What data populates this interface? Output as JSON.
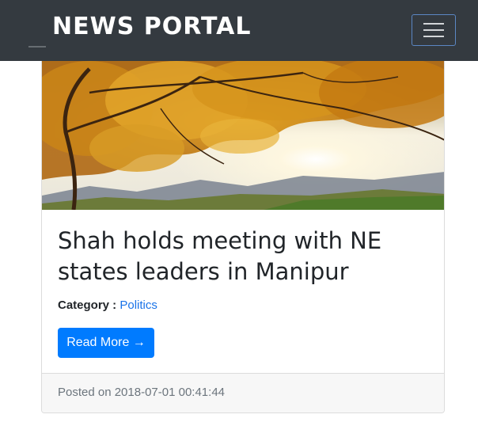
{
  "navbar": {
    "brand": "NEWS PORTAL",
    "menu_icon": "hamburger-menu-icon"
  },
  "post": {
    "image_icon": "autumn-tree-sunset-image",
    "title": "Shah holds meeting with NE states leaders in Manipur",
    "category_label": "Category :",
    "category_value": "Politics",
    "read_more_label": "Read More →",
    "posted_text": "Posted on 2018-07-01 00:41:44"
  },
  "colors": {
    "navbar_bg": "#343a40",
    "primary": "#007bff",
    "link": "#1a73e8",
    "footer_bg": "#f7f7f7"
  }
}
